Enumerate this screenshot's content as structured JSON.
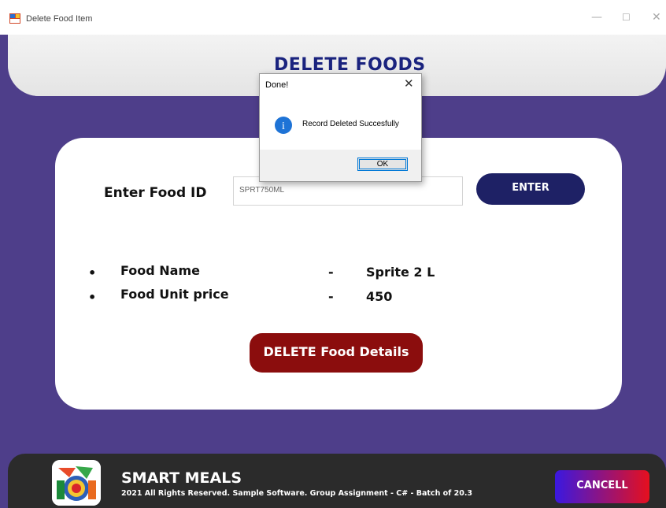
{
  "window": {
    "title": "Delete Food Item",
    "controls": {
      "minimize": "—",
      "maximize": "☐",
      "close": "✕"
    }
  },
  "header": {
    "title": "DELETE FOODS"
  },
  "form": {
    "food_id_label": "Enter Food ID",
    "food_id_value": "SPRT750ML",
    "enter_button": "ENTER",
    "bullet": "•",
    "details": [
      {
        "label": "Food Name",
        "dash": "-",
        "value": "Sprite 2 L"
      },
      {
        "label": "Food Unit price",
        "dash": "-",
        "value": "450"
      }
    ],
    "delete_button": "DELETE Food Details"
  },
  "footer": {
    "brand": "SMART MEALS",
    "subtitle": "2021 All Rights Reserved.  Sample Software. Group Assignment - C# - Batch of 20.3",
    "cancel_button": "CANCELL"
  },
  "dialog": {
    "title": "Done!",
    "close_glyph": "✕",
    "message": "Record Deleted Succesfully",
    "info_glyph": "i",
    "ok_button": "OK"
  },
  "colors": {
    "background": "#4e3e8a",
    "title_text": "#1a237e",
    "enter_button": "#1e2165",
    "delete_button": "#8b0d0d",
    "footer": "#2b2b2b",
    "cancel_gradient_start": "#3a18e0",
    "cancel_gradient_end": "#e6101e",
    "info_icon": "#1e73d6"
  },
  "icons": {
    "app": "app-window-icon",
    "info": "info-icon",
    "logo": "smart-meals-logo"
  }
}
